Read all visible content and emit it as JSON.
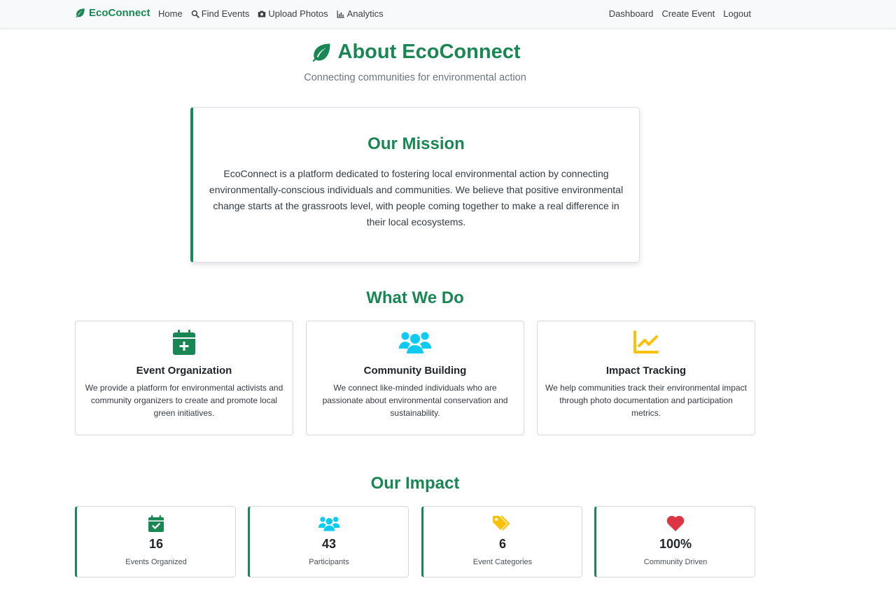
{
  "nav": {
    "brand": "EcoConnect",
    "left": [
      {
        "label": "Home",
        "icon": ""
      },
      {
        "label": "Find Events",
        "icon": "search-icon"
      },
      {
        "label": "Upload Photos",
        "icon": "camera-icon"
      },
      {
        "label": "Analytics",
        "icon": "chart-bar-icon"
      }
    ],
    "right": [
      {
        "label": "Dashboard"
      },
      {
        "label": "Create Event"
      },
      {
        "label": "Logout"
      }
    ]
  },
  "hero": {
    "title": "About EcoConnect",
    "subtitle": "Connecting communities for environmental action"
  },
  "mission": {
    "title": "Our Mission",
    "text": "EcoConnect is a platform dedicated to fostering local environmental action by connecting environmentally-conscious individuals and communities. We believe that positive environmental change starts at the grassroots level, with people coming together to make a real difference in their local ecosystems."
  },
  "what_we_do": {
    "title": "What We Do",
    "cards": [
      {
        "icon": "calendar-plus-icon",
        "title": "Event Organization",
        "text": "We provide a platform for environmental activists and community organizers to create and promote local green initiatives."
      },
      {
        "icon": "users-icon",
        "title": "Community Building",
        "text": "We connect like-minded individuals who are passionate about environmental conservation and sustainability."
      },
      {
        "icon": "chart-line-icon",
        "title": "Impact Tracking",
        "text": "We help communities track their environmental impact through photo documentation and participation metrics."
      }
    ]
  },
  "impact": {
    "title": "Our Impact",
    "stats": [
      {
        "icon": "calendar-check-icon",
        "value": "16",
        "label": "Events Organized"
      },
      {
        "icon": "users-icon",
        "value": "43",
        "label": "Participants"
      },
      {
        "icon": "tags-icon",
        "value": "6",
        "label": "Event Categories"
      },
      {
        "icon": "heart-icon",
        "value": "100%",
        "label": "Community Driven"
      }
    ]
  },
  "colors": {
    "brand_green": "#198754",
    "info_cyan": "#0dcaf0",
    "warning_yellow": "#ffc107",
    "danger_red": "#dc3545"
  }
}
